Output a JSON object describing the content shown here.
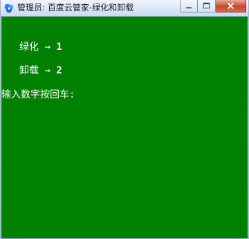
{
  "window": {
    "title": "管理员: 百度云管家-绿化和卸载"
  },
  "title_controls": {
    "minimize_icon": "minimize-icon",
    "maximize_icon": "maximize-icon",
    "close_icon": "close-icon"
  },
  "colors": {
    "console_background": "#008000",
    "console_text": "#ffffff"
  },
  "console": {
    "menu": [
      {
        "label": "绿化",
        "arrow": "→",
        "key": "1"
      },
      {
        "label": "卸载",
        "arrow": "→",
        "key": "2"
      }
    ],
    "prompt": "输入数字按回车:"
  }
}
